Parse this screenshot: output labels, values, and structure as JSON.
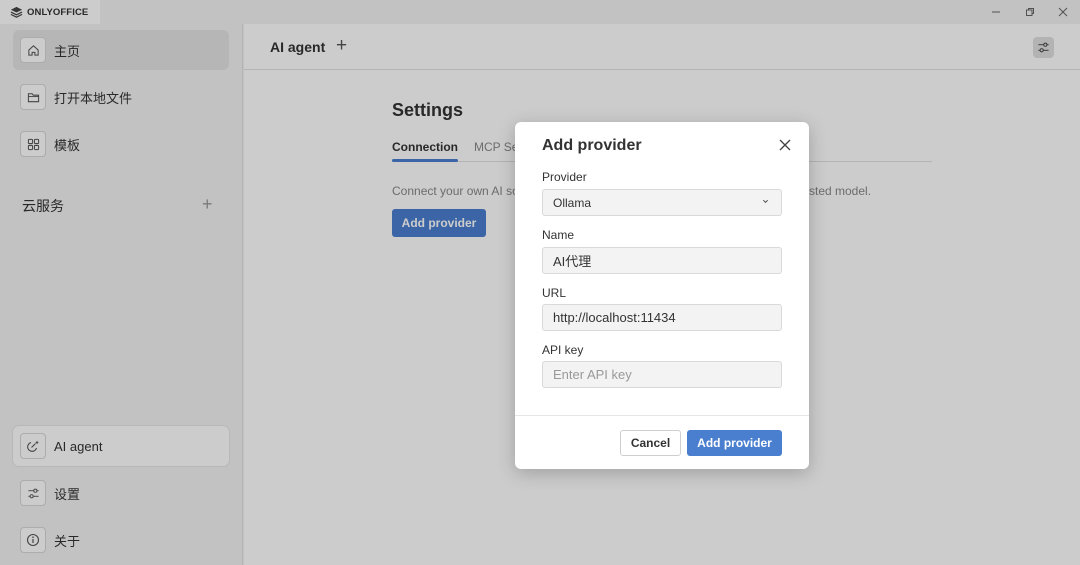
{
  "window": {
    "brand": "ONLYOFFICE",
    "icons": [
      "minimize-icon",
      "restore-icon",
      "close-icon"
    ]
  },
  "sidebar": {
    "items": [
      {
        "label": "主页",
        "icon": "home-icon"
      },
      {
        "label": "打开本地文件",
        "icon": "folder-icon"
      },
      {
        "label": "模板",
        "icon": "grid-icon"
      }
    ],
    "cloud_label": "云服务",
    "cloud_add": "+",
    "bottom_items": [
      {
        "label": "AI agent",
        "icon": "ai-agent-icon"
      },
      {
        "label": "设置",
        "icon": "sliders-icon"
      },
      {
        "label": "关于",
        "icon": "info-icon"
      }
    ]
  },
  "main": {
    "tab_title": "AI agent",
    "tab_add": "+",
    "settings_title": "Settings",
    "tabs": [
      "Connection",
      "MCP Se"
    ],
    "description_left": "Connect your own AI so",
    "description_right": "sted model.",
    "add_provider_label": "Add provider"
  },
  "modal": {
    "title": "Add provider",
    "provider_label": "Provider",
    "provider_value": "Ollama",
    "name_label": "Name",
    "name_value": "AI代理",
    "url_label": "URL",
    "url_value": "http://localhost:11434",
    "api_key_label": "API key",
    "api_key_placeholder": "Enter API key",
    "cancel_label": "Cancel",
    "confirm_label": "Add provider"
  },
  "colors": {
    "accent": "#4a7fd0",
    "sidebar_bg": "#f3f3f3",
    "overlay": "rgba(0,0,0,0.2)"
  }
}
